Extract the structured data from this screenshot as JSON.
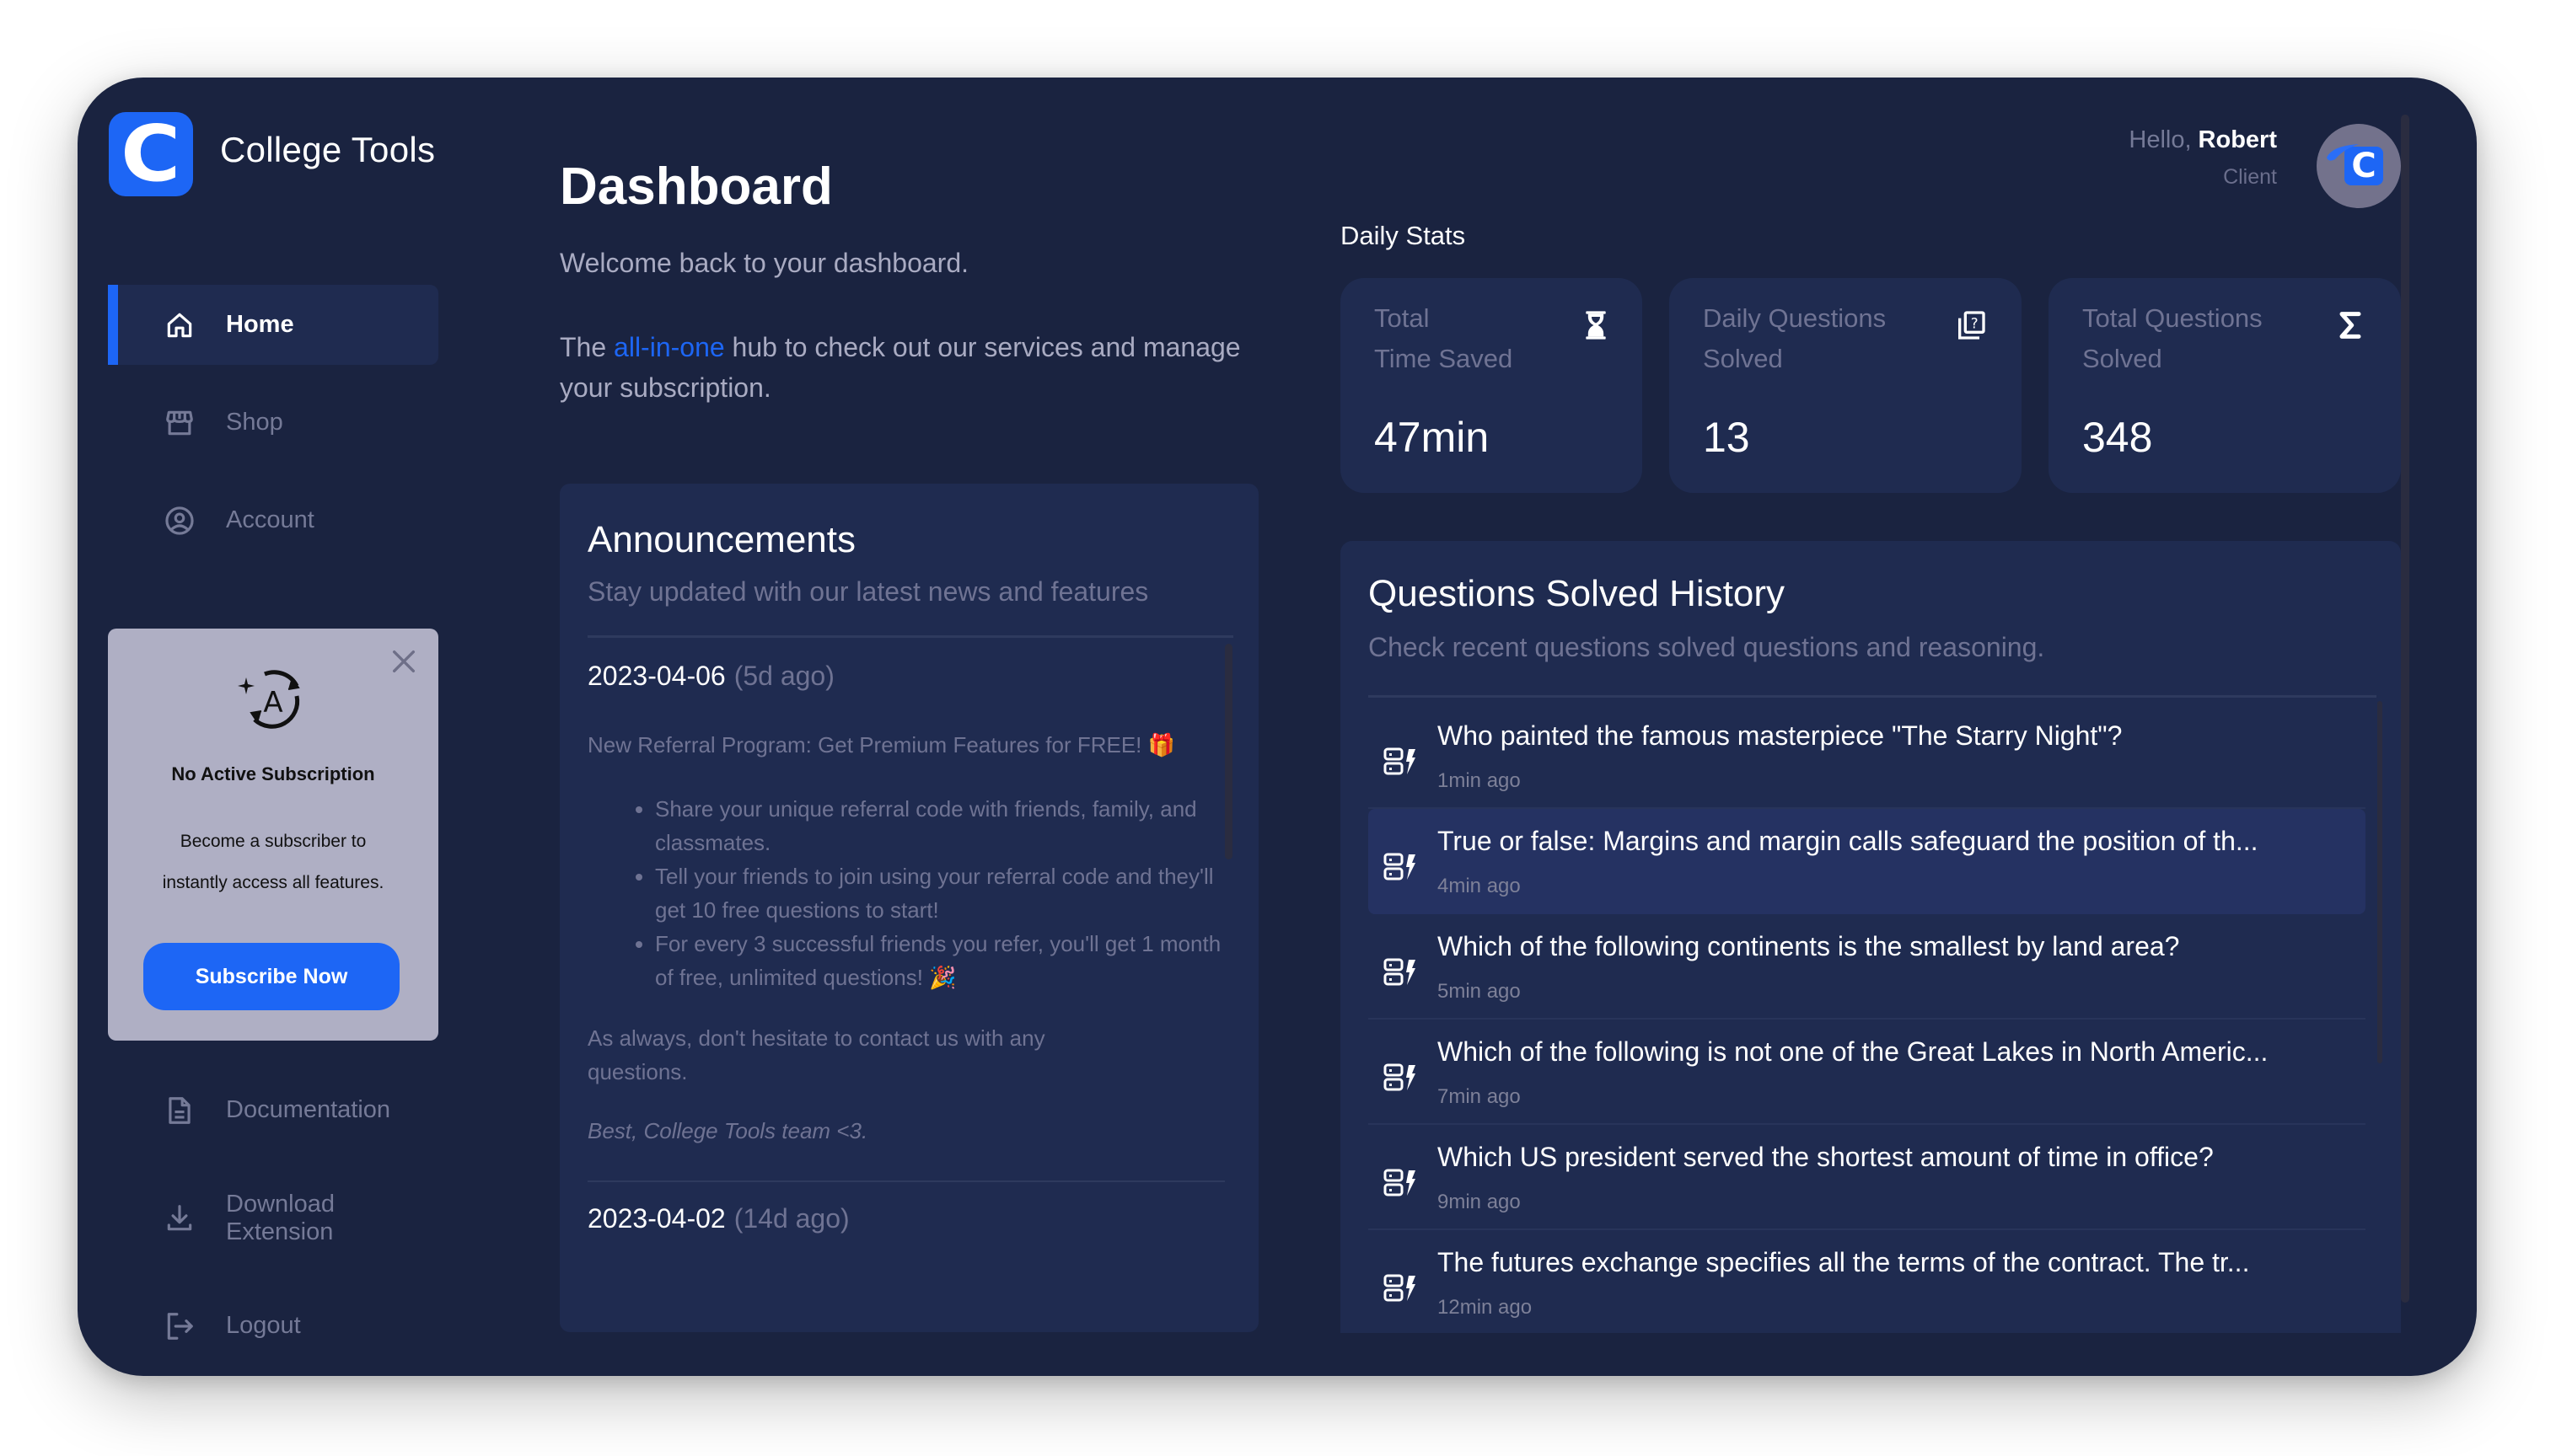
{
  "app": {
    "brand": "College Tools",
    "logo_letter": "C"
  },
  "sidebar": {
    "items": [
      {
        "label": "Home",
        "icon": "home-icon",
        "active": true
      },
      {
        "label": "Shop",
        "icon": "storefront-icon",
        "active": false
      },
      {
        "label": "Account",
        "icon": "user-circle-icon",
        "active": false
      },
      {
        "label": "Documentation",
        "icon": "document-icon",
        "active": false
      },
      {
        "label": "Download Extension",
        "icon": "download-icon",
        "active": false
      },
      {
        "label": "Logout",
        "icon": "logout-icon",
        "active": false
      }
    ],
    "subscription": {
      "title": "No Active Subscription",
      "desc_line1": "Become a subscriber to",
      "desc_line2": "instantly access all features.",
      "button": "Subscribe Now"
    }
  },
  "header": {
    "title": "Dashboard",
    "welcome": "Welcome back to your dashboard.",
    "tagline_pre": "The ",
    "tagline_highlight": "all-in-one",
    "tagline_post": " hub to check out our services and manage your subscription."
  },
  "user": {
    "hello": "Hello,",
    "name": "Robert",
    "role": "Client",
    "avatar_letter": "C"
  },
  "announcements": {
    "title": "Announcements",
    "subtitle": "Stay updated with our latest news and features",
    "entries": [
      {
        "date": "2023-04-06",
        "ago": "(5d ago)",
        "headline": "New Referral Program: Get Premium Features for FREE! 🎁",
        "bullets": [
          "Share your unique referral code with friends, family, and classmates.",
          "Tell your friends to join using your referral code and they'll get 10 free questions to start!",
          "For every 3 successful friends you refer, you'll get 1 month of free, unlimited questions! 🎉"
        ],
        "closing": "As always, don't hesitate to contact us with any questions.",
        "signature": "Best, College Tools team <3."
      },
      {
        "date": "2023-04-02",
        "ago": "(14d ago)"
      }
    ]
  },
  "daily_stats": {
    "label": "Daily Stats",
    "cards": [
      {
        "label": "Total Time Saved",
        "label_line1": "Total",
        "label_line2": "Time Saved",
        "value": "47min",
        "icon": "hourglass-icon"
      },
      {
        "label": "Daily Questions Solved",
        "label_line1": "Daily Questions",
        "label_line2": "Solved",
        "value": "13",
        "icon": "question-stack-icon"
      },
      {
        "label": "Total Questions Solved",
        "label_line1": "Total Questions",
        "label_line2": "Solved",
        "value": "348",
        "icon": "sigma-icon"
      }
    ]
  },
  "history": {
    "title": "Questions Solved History",
    "subtitle": "Check recent questions solved questions and reasoning.",
    "items": [
      {
        "question": "Who painted the famous masterpiece \"The Starry Night\"?",
        "ago": "1min ago"
      },
      {
        "question": "True or false: Margins and margin calls safeguard the position of th...",
        "ago": "4min ago"
      },
      {
        "question": "Which of the following continents is the smallest by land area?",
        "ago": "5min ago"
      },
      {
        "question": "Which of the following is not one of the Great Lakes in North Americ...",
        "ago": "7min ago"
      },
      {
        "question": "Which US president served the shortest amount of time in office?",
        "ago": "9min ago"
      },
      {
        "question": "The futures exchange specifies all the terms of the contract. The tr...",
        "ago": "12min ago"
      }
    ]
  },
  "colors": {
    "background": "#1a2340",
    "card": "#1f2b50",
    "accent": "#1d66f5",
    "muted_text": "#6f7393",
    "subscription_card": "#afafc4"
  }
}
